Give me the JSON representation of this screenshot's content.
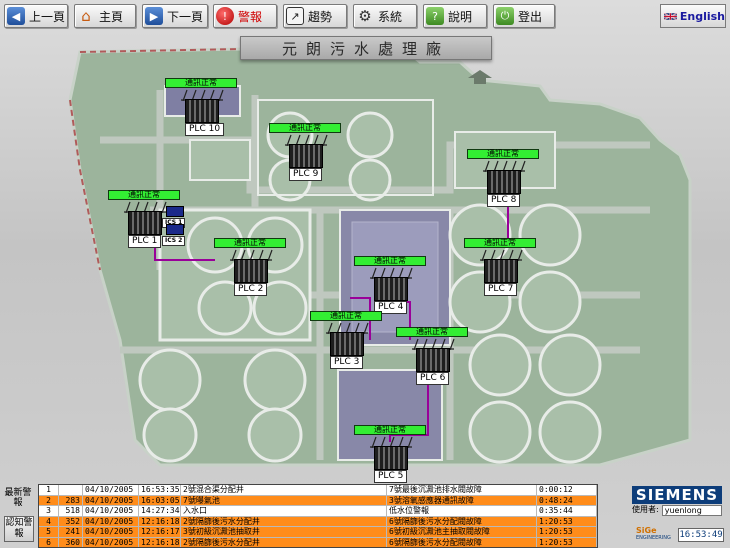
{
  "toolbar": {
    "prev_page": {
      "label": "上一頁",
      "icon": "left-arrow-icon"
    },
    "home": {
      "label": "主頁",
      "icon": "house-icon"
    },
    "next_page": {
      "label": "下一頁",
      "icon": "right-arrow-icon"
    },
    "alarm": {
      "label": "警報",
      "icon": "alarm-icon"
    },
    "trend": {
      "label": "趨勢",
      "icon": "trend-icon"
    },
    "system": {
      "label": "系統",
      "icon": "gear-icon"
    },
    "help": {
      "label": "說明",
      "icon": "help-icon"
    },
    "logout": {
      "label": "登出",
      "icon": "power-icon"
    },
    "language": {
      "label": "English",
      "icon": "uk-flag-icon"
    }
  },
  "page_title": "元朗污水處理廠",
  "plant": {
    "plcs": [
      {
        "id": "plc10",
        "label": "PLC 10",
        "status": "通訊正常"
      },
      {
        "id": "plc9",
        "label": "PLC 9",
        "status": "通訊正常"
      },
      {
        "id": "plc8",
        "label": "PLC 8",
        "status": "通訊正常"
      },
      {
        "id": "plc1",
        "label": "PLC 1",
        "status": "通訊正常"
      },
      {
        "id": "plc2",
        "label": "PLC 2",
        "status": "通訊正常"
      },
      {
        "id": "plc7",
        "label": "PLC 7",
        "status": "通訊正常"
      },
      {
        "id": "plc4",
        "label": "PLC 4",
        "status": "通訊正常"
      },
      {
        "id": "plc3",
        "label": "PLC 3",
        "status": "通訊正常"
      },
      {
        "id": "plc6",
        "label": "PLC 6",
        "status": "通訊正常"
      },
      {
        "id": "plc5",
        "label": "PLC 5",
        "status": "通訊正常"
      }
    ],
    "ics": [
      {
        "id": "ics1",
        "label": "ICS 1"
      },
      {
        "id": "ics2",
        "label": "ICS 2"
      }
    ],
    "colors": {
      "ground": "#9cb49c",
      "road": "#b9c2b9",
      "tank": "#a9bfa9",
      "tank_rim": "#e8ece8",
      "building": "#8888a8",
      "link": "#990099",
      "status_ok": "#33ee33"
    }
  },
  "alarm_panel": {
    "latest_alarm_label": "最新警報",
    "ack_button_label": "認知警報",
    "rows": [
      {
        "idx": "1",
        "code": "",
        "date": "04/10/2005",
        "time": "16:53:35",
        "location": "2號混合渠分配井",
        "desc": "7號最後沉澱池排水閥故障",
        "duration": "0:00:12",
        "level": "white"
      },
      {
        "idx": "2",
        "code": "283",
        "date": "04/10/2005",
        "time": "16:03:05",
        "location": "7號曝氣池",
        "desc": "3號溶氧感應器通訊故障",
        "duration": "0:48:24",
        "level": "orange"
      },
      {
        "idx": "3",
        "code": "518",
        "date": "04/10/2005",
        "time": "14:27:34",
        "location": "入水口",
        "desc": "低水位警報",
        "duration": "0:35:44",
        "level": "white"
      },
      {
        "idx": "4",
        "code": "352",
        "date": "04/10/2005",
        "time": "12:16:18",
        "location": "2號隔篩後污水分配井",
        "desc": "6號隔篩後污水分配閥故障",
        "duration": "1:20:53",
        "level": "orange"
      },
      {
        "idx": "5",
        "code": "241",
        "date": "04/10/2005",
        "time": "12:16:17",
        "location": "3號初級沉澱池抽取井",
        "desc": "6號初級沉澱池主抽取閥故障",
        "duration": "1:20:53",
        "level": "orange"
      },
      {
        "idx": "6",
        "code": "360",
        "date": "04/10/2005",
        "time": "12:16:18",
        "location": "2號隔篩後污水分配井",
        "desc": "6號隔篩後污水分配閥故障",
        "duration": "1:20:53",
        "level": "orange"
      }
    ]
  },
  "brand": {
    "name": "SIEMENS",
    "color": "#0d3d7a"
  },
  "user": {
    "label": "使用者:",
    "name": "yuenlong"
  },
  "engineering_logo": {
    "big": "SiGe",
    "small": "ENGINEERING"
  },
  "clock": "16:53:49"
}
